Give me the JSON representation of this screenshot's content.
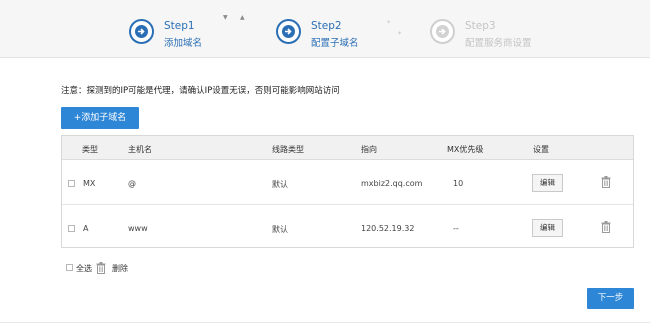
{
  "colors": {
    "accent": "#2d86d6",
    "step_active": "#2a6fb5",
    "step_disabled": "#c4c4c4"
  },
  "steps": [
    {
      "num": "Step1",
      "name": "添加域名",
      "state": "active",
      "icon": "arrow-right-icon"
    },
    {
      "num": "Step2",
      "name": "配置子域名",
      "state": "active",
      "icon": "arrow-right-icon"
    },
    {
      "num": "Step3",
      "name": "配置服务商设置",
      "state": "disabled",
      "icon": "arrow-right-icon"
    }
  ],
  "notice": "注意：探测到的IP可能是代理，请确认IP设置无误，否则可能影响网站访问",
  "add_button": "+添加子域名",
  "table": {
    "headers": [
      "类型",
      "主机名",
      "线路类型",
      "指向",
      "MX优先级",
      "设置"
    ],
    "rows": [
      {
        "type": "MX",
        "host": "@",
        "line": "默认",
        "target": "mxbiz2.qq.com",
        "mx": "10",
        "edit": "编辑"
      },
      {
        "type": "A",
        "host": "www",
        "line": "默认",
        "target": "120.52.19.32",
        "mx": "--",
        "edit": "编辑"
      }
    ]
  },
  "footer": {
    "select_all": "全选",
    "delete": "删除"
  },
  "next_button": "下一步"
}
